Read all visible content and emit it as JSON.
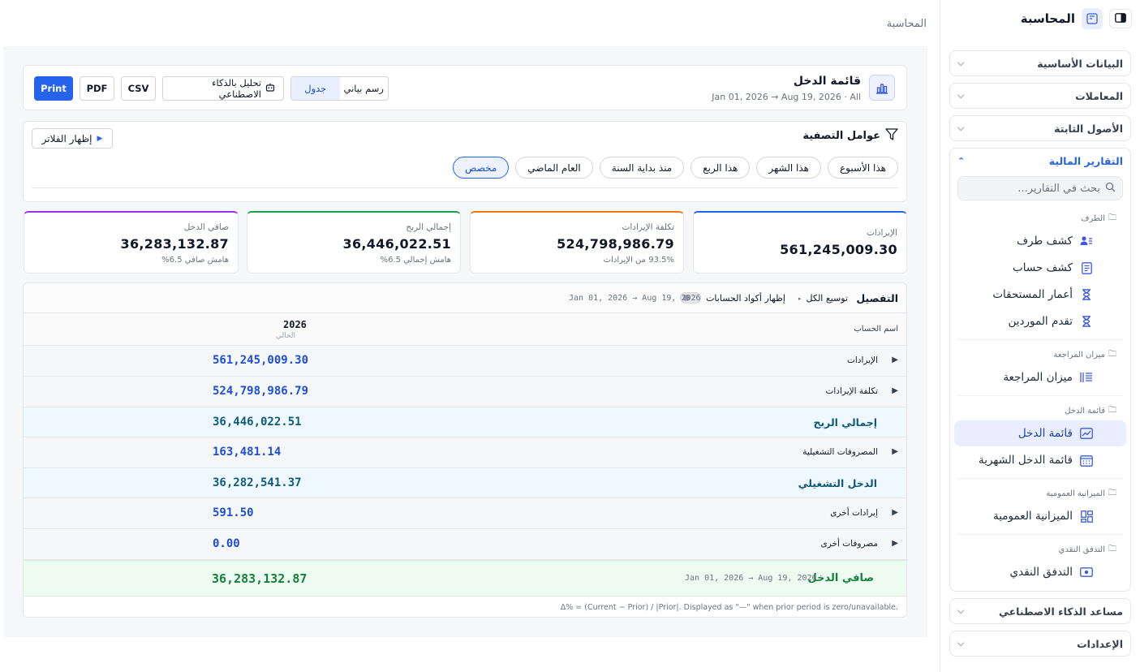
{
  "sidebar": {
    "title": "المحاسبة",
    "sections": {
      "master_data": "البيانات الأساسية",
      "transactions": "المعاملات",
      "fixed_assets": "الأصول الثابتة",
      "financial_reports": "التقارير المالية",
      "ai_assistant": "مساعد الذكاء الاصطناعي",
      "settings": "الإعدادات"
    },
    "search_placeholder": "بحث في التقارير...",
    "groups": {
      "party": "الطرف",
      "trial": "ميزان المراجعة",
      "income": "قائمة الدخل",
      "balance": "الميزانية العمومية",
      "cash": "التدفق النقدي"
    },
    "items": {
      "party_statement": "كشف طرف",
      "account_statement": "كشف حساب",
      "receivables_aging": "أعمار المستحقات",
      "suppliers_aging": "تقدم الموردين",
      "trial_balance": "ميزان المراجعة",
      "income_statement": "قائمة الدخل",
      "monthly_income": "قائمة الدخل الشهرية",
      "balance_sheet": "الميزانية العمومية",
      "cash_flow": "التدفق النقدي"
    }
  },
  "breadcrumb": "المحاسبة",
  "header": {
    "title": "قائمة الدخل",
    "subtitle": "Jan 01, 2026 → Aug 19, 2026 · All",
    "buttons": {
      "print": "Print",
      "pdf": "PDF",
      "csv": "CSV",
      "ai": "تحليل بالذكاء الاصطناعي"
    },
    "view": {
      "table": "جدول",
      "chart": "رسم بياني"
    }
  },
  "filters": {
    "title": "عوامل التصفية",
    "show": "إظهار الفلاتر",
    "chips": [
      "هذا الأسبوع",
      "هذا الشهر",
      "هذا الربع",
      "منذ بداية السنة",
      "العام الماضي",
      "مخصص"
    ],
    "selected": "مخصص"
  },
  "kpis": [
    {
      "label": "الإيرادات",
      "value": "561,245,009.30",
      "sub": "",
      "color": "#2563eb"
    },
    {
      "label": "تكلفة الإيرادات",
      "value": "524,798,986.79",
      "sub": "93.5% من الإيرادات",
      "color": "#ea7a0c"
    },
    {
      "label": "إجمالي الربح",
      "value": "36,446,022.51",
      "sub": "هامش إجمالي 6.5%",
      "color": "#16a34a"
    },
    {
      "label": "صافي الدخل",
      "value": "36,283,132.87",
      "sub": "هامش صافي 6.5%",
      "color": "#9333ea"
    }
  ],
  "details": {
    "title": "التفصيل",
    "expand_all": "توسيع الكل",
    "show_codes": "إظهار أكواد الحسابات",
    "range": "Jan 01, 2026 → Aug 19, 2026",
    "account_col": "اسم الحساب",
    "year": "2026",
    "current": "الحالي",
    "rows": {
      "revenue": {
        "name": "الإيرادات",
        "amount": "561,245,009.30"
      },
      "cogs": {
        "name": "تكلفة الإيرادات",
        "amount": "524,798,986.79"
      },
      "gross": {
        "name": "إجمالي الربح",
        "amount": "36,446,022.51"
      },
      "opex": {
        "name": "المصروفات التشغيلية",
        "amount": "163,481.14"
      },
      "operating": {
        "name": "الدخل التشغيلي",
        "amount": "36,282,541.37"
      },
      "other_income": {
        "name": "إيرادات أخرى",
        "amount": "591.50"
      },
      "other_expenses": {
        "name": "مصروفات أخرى",
        "amount": "0.00"
      },
      "net": {
        "name": "صافي الدخل",
        "range": "Jan 01, 2026 → Aug 19, 2026",
        "amount": "36,283,132.87"
      }
    },
    "footnote": "Δ% = (Current − Prior) / |Prior|. Displayed as \"—\" when prior period is zero/unavailable."
  }
}
